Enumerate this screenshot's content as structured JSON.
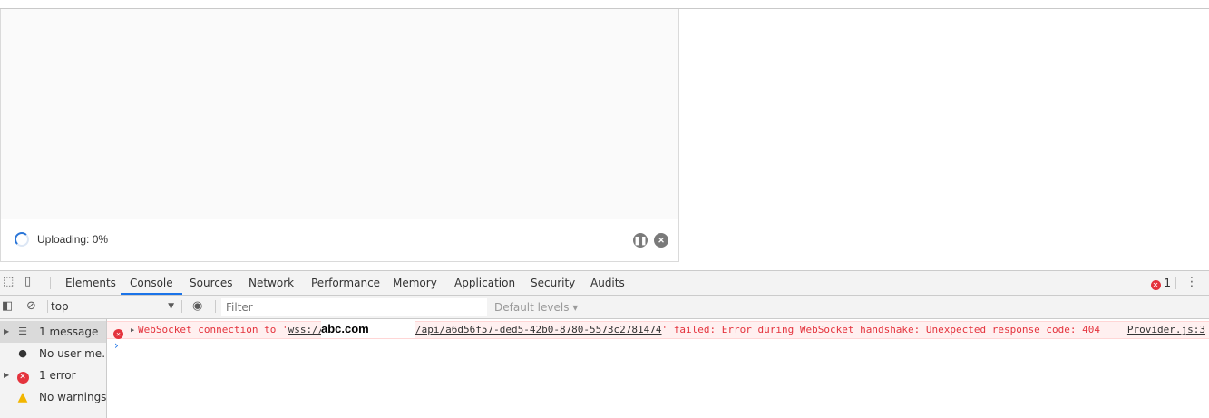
{
  "upload": {
    "status": "Uploading: 0%"
  },
  "devtools": {
    "tabs": [
      "Elements",
      "Console",
      "Sources",
      "Network",
      "Performance",
      "Memory",
      "Application",
      "Security",
      "Audits"
    ],
    "active_tab": "Console",
    "error_count": "1",
    "context": "top",
    "filter_placeholder": "Filter",
    "levels_label": "Default levels ▾",
    "sidebar": [
      {
        "label": "1 message"
      },
      {
        "label": "No user me..."
      },
      {
        "label": "1 error"
      },
      {
        "label": "No warnings"
      }
    ],
    "error": {
      "prefix": "WebSocket connection to '",
      "url_start": "wss://",
      "redacted_host": "abc.com",
      "url_end": "/api/a6d56f57-ded5-42b0-8780-5573c2781474",
      "suffix": "' failed: Error during WebSocket handshake: Unexpected response code: 404",
      "source": "Provider.js:3"
    },
    "prompt": "›"
  },
  "colors": {
    "accent": "#1a73e8",
    "error": "#e4333d",
    "warning": "#f2b600"
  }
}
